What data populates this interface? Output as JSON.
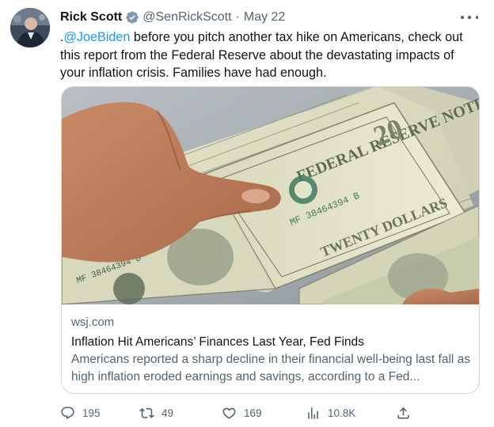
{
  "author": {
    "name": "Rick Scott",
    "handle": "@SenRickScott",
    "separator": "·",
    "date": "May 22"
  },
  "tweet": {
    "prefix": ".",
    "mention": "@JoeBiden",
    "text": " before you pitch another tax hike on Americans, check out this report from the Federal Reserve about the devastating impacts of your inflation crisis. Families have had enough."
  },
  "card": {
    "domain": "wsj.com",
    "title": "Inflation Hit Americans’ Finances Last Year, Fed Finds",
    "description": "Americans reported a sharp decline in their financial well-being last fall as high inflation eroded earnings and savings, according to a Fed..."
  },
  "actions": {
    "replies": "195",
    "reposts": "49",
    "likes": "169",
    "views": "10.8K"
  },
  "icons": {
    "verified": "verified-badge-icon",
    "more": "more-icon",
    "reply": "reply-icon",
    "repost": "repost-icon",
    "like": "like-icon",
    "views": "views-icon",
    "share": "share-icon"
  },
  "colors": {
    "accent": "#1d9bf0",
    "text": "#0f1419",
    "secondary": "#536471",
    "border": "#cfd9de"
  }
}
